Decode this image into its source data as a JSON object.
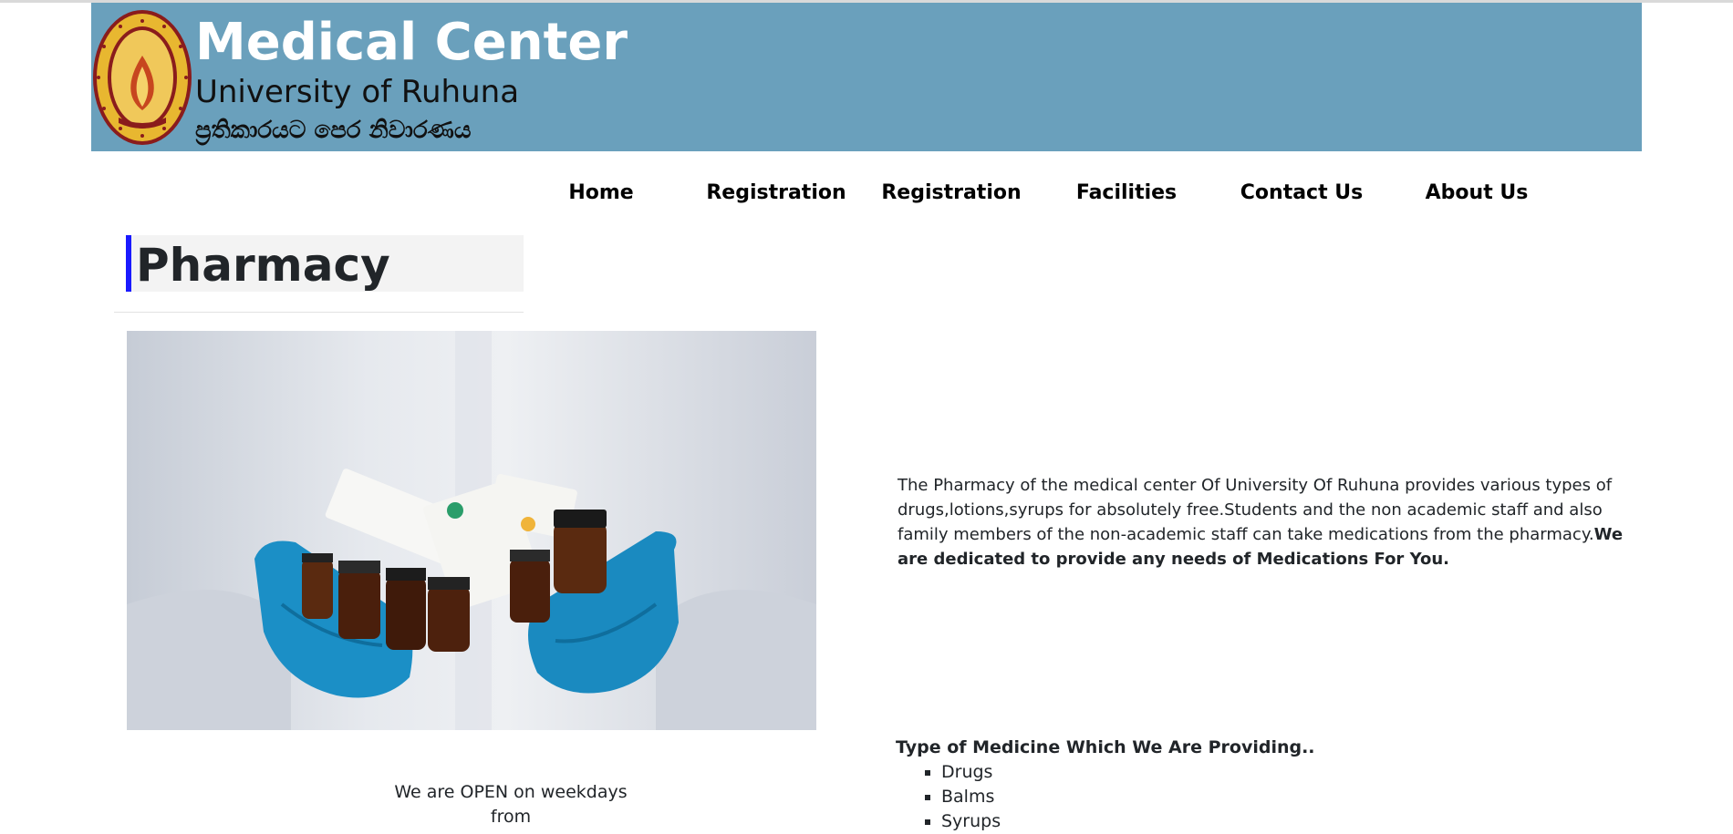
{
  "header": {
    "title": "Medical Center",
    "subtitle": "University of Ruhuna",
    "motto": "ප්‍රතිකාරයට පෙර නිවාරණය"
  },
  "nav": {
    "items": [
      {
        "label": "Home"
      },
      {
        "label": "Registration"
      },
      {
        "label": "Registration"
      },
      {
        "label": "Facilities"
      },
      {
        "label": "Contact Us"
      },
      {
        "label": "About Us"
      }
    ]
  },
  "page": {
    "heading": "Pharmacy",
    "open_line1": "We are OPEN on weekdays",
    "open_line2": "from"
  },
  "description": {
    "text": "The Pharmacy of the medical center Of University Of Ruhuna provides various types of drugs,lotions,syrups for absolutely free.Students and the non academic staff and also family members of the non-academic staff can take medications from the pharmacy.",
    "bold": "We are dedicated to provide any needs of Medications For You."
  },
  "medicines": {
    "heading": "Type of Medicine Which We Are Providing..",
    "items": [
      "Drugs",
      "Balms",
      "Syrups"
    ]
  },
  "colors": {
    "header_bg": "#6aa0bc",
    "heading_accent": "#1a1aff",
    "glove_blue": "#1b8fc6"
  }
}
